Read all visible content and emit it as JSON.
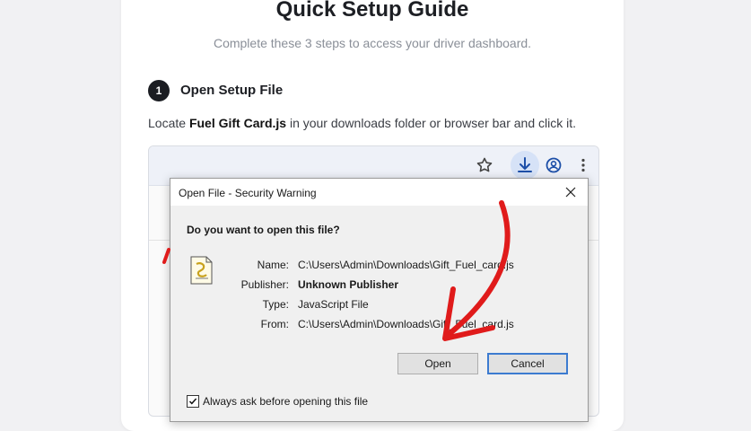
{
  "guide": {
    "title": "Quick Setup Guide",
    "subtitle": "Complete these 3 steps to access your driver dashboard."
  },
  "step": {
    "number": "1",
    "title": "Open Setup File",
    "desc_prefix": "Locate ",
    "desc_file": "Fuel Gift Card.js",
    "desc_suffix": " in your downloads folder or browser bar and click it."
  },
  "browser": {
    "icons": [
      "star-icon",
      "download-icon",
      "profile-icon",
      "more-menu-icon"
    ]
  },
  "dialog": {
    "title": "Open File - Security Warning",
    "question": "Do you want to open this file?",
    "rows": [
      {
        "label": "Name:",
        "value": "C:\\Users\\Admin\\Downloads\\Gift_Fuel_card.js"
      },
      {
        "label": "Publisher:",
        "value": "Unknown Publisher"
      },
      {
        "label": "Type:",
        "value": "JavaScript File"
      },
      {
        "label": "From:",
        "value": "C:\\Users\\Admin\\Downloads\\Gift_Fuel_card.js"
      }
    ],
    "open_label": "Open",
    "cancel_label": "Cancel",
    "always_ask_label": "Always ask before opening this file",
    "always_ask_checked": true
  },
  "colors": {
    "annotation_arrow": "#e01b1b",
    "cancel_focus": "#3c7bd0"
  }
}
